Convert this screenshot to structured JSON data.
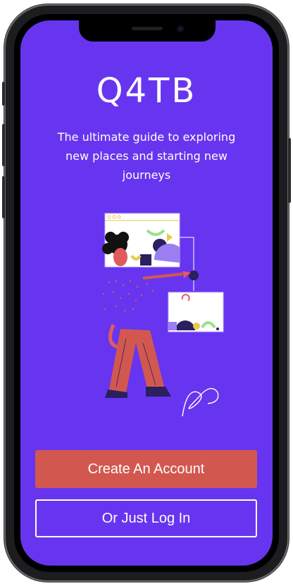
{
  "app": {
    "title": "Q4TB",
    "tagline": "The ultimate guide to exploring new places and starting new journeys"
  },
  "actions": {
    "create_account_label": "Create An Account",
    "login_label": "Or Just Log In"
  },
  "colors": {
    "background": "#6735ef",
    "primary_button": "#d2584f",
    "text": "#ffffff"
  },
  "illustration": {
    "icon": "person-arranging-shapes-illustration"
  }
}
